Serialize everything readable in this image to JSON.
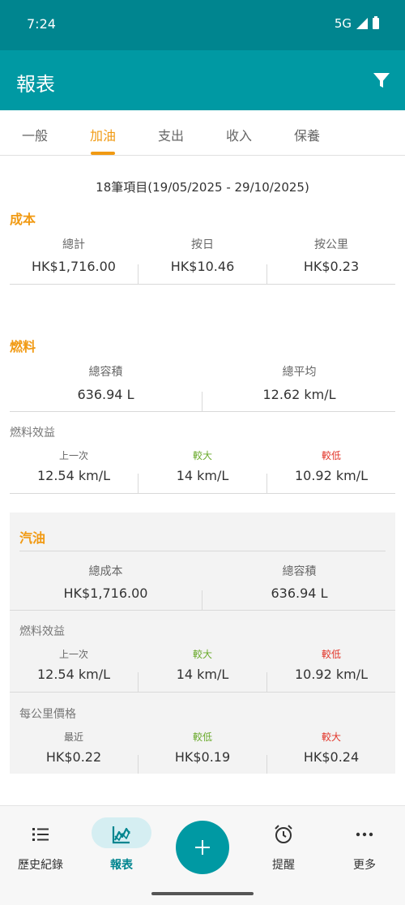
{
  "status_bar": {
    "time": "7:24",
    "network": "5G"
  },
  "app_bar": {
    "title": "報表"
  },
  "tabs": [
    {
      "label": "一般",
      "active": false
    },
    {
      "label": "加油",
      "active": true
    },
    {
      "label": "支出",
      "active": false
    },
    {
      "label": "收入",
      "active": false
    },
    {
      "label": "保養",
      "active": false
    }
  ],
  "summary": "18筆項目(19/05/2025 - 29/10/2025)",
  "cost": {
    "title": "成本",
    "total_label": "總計",
    "total_value": "HK$1,716.00",
    "per_day_label": "按日",
    "per_day_value": "HK$10.46",
    "per_km_label": "按公里",
    "per_km_value": "HK$0.23"
  },
  "fuel": {
    "title": "燃料",
    "volume_label": "總容積",
    "volume_value": "636.94 L",
    "avg_label": "總平均",
    "avg_value": "12.62 km/L",
    "efficiency": {
      "caption": "燃料效益",
      "last_label": "上一次",
      "last_value": "12.54 km/L",
      "high_label": "較大",
      "high_value": "14 km/L",
      "low_label": "較低",
      "low_value": "10.92 km/L"
    }
  },
  "petrol": {
    "title": "汽油",
    "cost_label": "總成本",
    "cost_value": "HK$1,716.00",
    "volume_label": "總容積",
    "volume_value": "636.94 L",
    "efficiency": {
      "caption": "燃料效益",
      "last_label": "上一次",
      "last_value": "12.54 km/L",
      "high_label": "較大",
      "high_value": "14 km/L",
      "low_label": "較低",
      "low_value": "10.92 km/L"
    },
    "price_per_km": {
      "caption": "每公里價格",
      "recent_label": "最近",
      "recent_value": "HK$0.22",
      "low_label": "較低",
      "low_value": "HK$0.19",
      "high_label": "較大",
      "high_value": "HK$0.24"
    }
  },
  "bottom_nav": {
    "history": "歷史紀錄",
    "reports": "報表",
    "reminders": "提醒",
    "more": "更多"
  },
  "colors": {
    "primary": "#0099a3",
    "accent": "#f19a13",
    "green": "#6aaa2c",
    "red": "#e2362a"
  }
}
